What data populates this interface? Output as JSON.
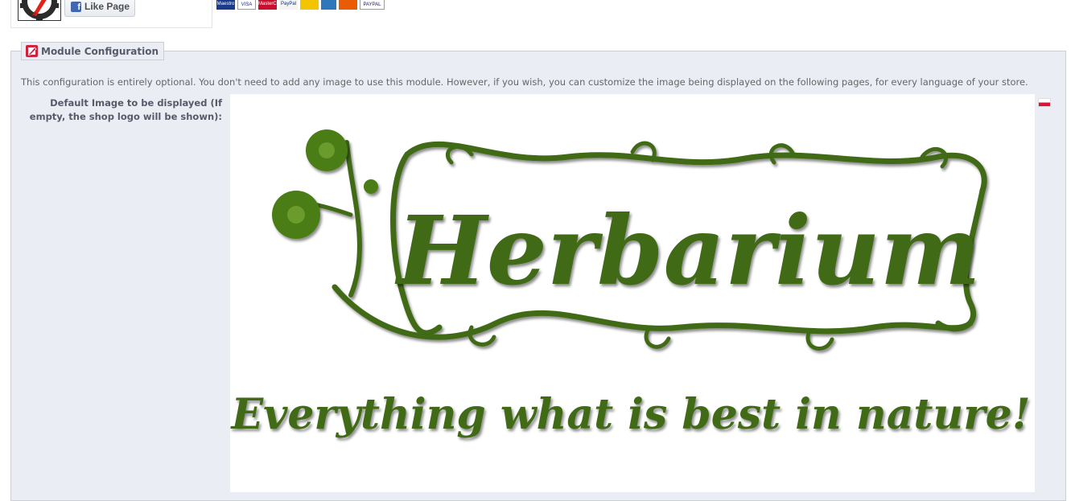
{
  "header": {
    "like_button_label": "Like Page",
    "fb_glyph": "f",
    "payment_cards": [
      {
        "name": "maestro-card",
        "text": "Maestro",
        "bg": "#1a3a8c",
        "fg": "#ffffff"
      },
      {
        "name": "visa-card",
        "text": "VISA",
        "bg": "#ffffff",
        "fg": "#1a1f71"
      },
      {
        "name": "mastercard-card",
        "text": "MasterCard",
        "bg": "#c8102e",
        "fg": "#ffffff"
      },
      {
        "name": "paypal-card",
        "text": "PayPal",
        "bg": "#f4f4f4",
        "fg": "#003087"
      },
      {
        "name": "card-five",
        "text": "",
        "bg": "#f2c500",
        "fg": "#333333"
      },
      {
        "name": "amex-card",
        "text": "",
        "bg": "#2e77bb",
        "fg": "#ffffff"
      },
      {
        "name": "card-seven",
        "text": "",
        "bg": "#e85d04",
        "fg": "#ffffff"
      },
      {
        "name": "paypal-text-card",
        "text": "PAYPAL",
        "bg": "#ffffff",
        "fg": "#1a1a6e"
      }
    ]
  },
  "module_config": {
    "legend": "Module Configuration",
    "intro": "This configuration is entirely optional. You don't need to add any image to use this module. However, if you wish, you can customize the image being displayed on the following pages, for every language of your store.",
    "field_label": "Default Image to be displayed (If empty, the shop logo will be shown):",
    "image": {
      "brand": "Herbarium",
      "tagline": "Everything what is best in nature!"
    },
    "language_flag": "pl-flag"
  },
  "colors": {
    "panel_bg": "#ebedf4",
    "herbarium_green": "#3f6a12",
    "accent_red": "#d0213d"
  }
}
